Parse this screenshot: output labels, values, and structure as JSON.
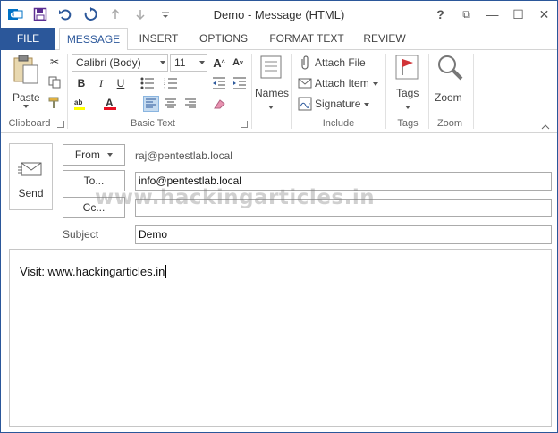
{
  "window": {
    "title": "Demo - Message (HTML)",
    "accent_color": "#2b579a",
    "controls": [
      "?",
      "⧉",
      "—",
      "☐",
      "✕"
    ]
  },
  "qat": {
    "icons": [
      "save-icon",
      "undo-icon",
      "redo-icon",
      "up-arrow-icon",
      "down-arrow-icon",
      "customize-icon"
    ]
  },
  "tabs": [
    {
      "label": "FILE"
    },
    {
      "label": "MESSAGE"
    },
    {
      "label": "INSERT"
    },
    {
      "label": "OPTIONS"
    },
    {
      "label": "FORMAT TEXT"
    },
    {
      "label": "REVIEW"
    }
  ],
  "ribbon": {
    "clipboard": {
      "label": "Clipboard",
      "paste": "Paste"
    },
    "basic_text": {
      "label": "Basic Text",
      "font": "Calibri (Body)",
      "size": "11",
      "bold": "B",
      "italic": "I",
      "underline": "U"
    },
    "names": {
      "label": "Names"
    },
    "include": {
      "label": "Include",
      "attach_file": "Attach File",
      "attach_item": "Attach Item",
      "signature": "Signature"
    },
    "tags": {
      "label": "Tags"
    },
    "zoom": {
      "label": "Zoom",
      "button": "Zoom"
    }
  },
  "header": {
    "send": "Send",
    "from_label": "From",
    "from_value": "raj@pentestlab.local",
    "to_label": "To...",
    "to_value": "info@pentestlab.local",
    "cc_label": "Cc...",
    "cc_value": "",
    "subject_label": "Subject",
    "subject_value": "Demo"
  },
  "body": {
    "text": "Visit: www.hackingarticles.in"
  },
  "watermark": "www.hackingarticles.in"
}
